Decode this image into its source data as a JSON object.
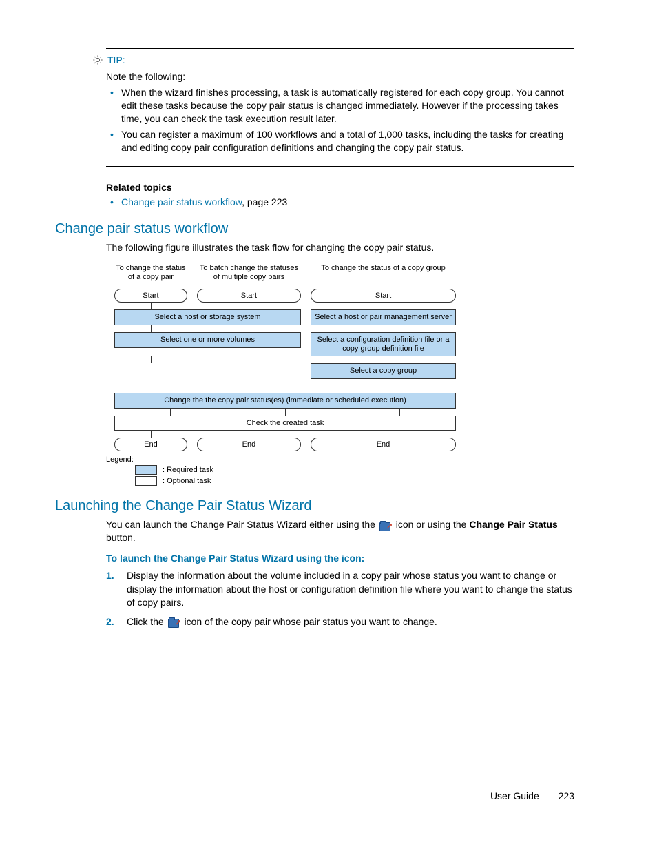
{
  "tip": {
    "label": "TIP:",
    "note": "Note the following:",
    "items": [
      "When the wizard finishes processing, a task is automatically registered for each copy group. You cannot edit these tasks because the copy pair status is changed immediately. However if the processing takes time, you can check the task execution result later.",
      "You can register a maximum of 100 workflows and a total of 1,000 tasks, including the tasks for creating and editing copy pair configuration definitions and changing the copy pair status."
    ]
  },
  "related": {
    "heading": "Related topics",
    "link": "Change pair status workflow",
    "suffix": ", page 223"
  },
  "section1": {
    "heading": "Change pair status workflow",
    "intro": "The following figure illustrates the task flow for changing the copy pair status."
  },
  "flow": {
    "cols": [
      "To change the status of a copy pair",
      "To batch change the statuses of multiple copy pairs",
      "To change the status of a copy group"
    ],
    "start": "Start",
    "r1_span2": "Select a host or storage system",
    "r1_c3": "Select a host or pair management server",
    "r2_span2": "Select one or more volumes",
    "r2_c3": "Select a configuration definition file or a copy group definition file",
    "r3_c3": "Select a copy group",
    "r4": "Change the the copy pair status(es) (immediate or scheduled execution)",
    "r5": "Check the created task",
    "end": "End",
    "legend_label": "Legend:",
    "legend_req": ": Required task",
    "legend_opt": ": Optional task"
  },
  "section2": {
    "heading": "Launching the Change Pair Status Wizard",
    "p_before": "You can launch the Change Pair Status Wizard either using the ",
    "p_mid": " icon or using the ",
    "p_bold": "Change Pair Status",
    "p_after": " button.",
    "sub": "To launch the Change Pair Status Wizard using the icon:",
    "steps": {
      "s1": "Display the information about the volume included in a copy pair whose status you want to change or display the information about the host or configuration definition file where you want to change the status of copy pairs.",
      "s2a": "Click the ",
      "s2b": " icon of the copy pair whose pair status you want to change."
    }
  },
  "footer": {
    "label": "User Guide",
    "page": "223"
  }
}
